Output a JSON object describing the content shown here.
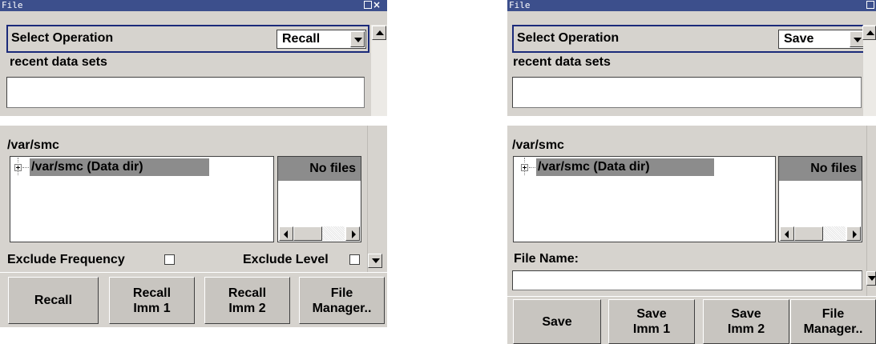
{
  "left": {
    "window_title": "File",
    "select_operation_label": "Select Operation",
    "operation_value": "Recall",
    "recent_label": "recent data sets",
    "path_label": "/var/smc",
    "tree_node": "/var/smc (Data dir)",
    "files_header": "No files",
    "exclude_frequency_label": "Exclude Frequency",
    "exclude_level_label": "Exclude Level",
    "buttons": [
      "Recall",
      "Recall\nImm 1",
      "Recall\nImm 2",
      "File\nManager.."
    ]
  },
  "right": {
    "window_title": "File",
    "select_operation_label": "Select Operation",
    "operation_value": "Save",
    "recent_label": "recent data sets",
    "path_label": "/var/smc",
    "tree_node": "/var/smc (Data dir)",
    "files_header": "No files",
    "file_name_label": "File Name:",
    "buttons": [
      "Save",
      "Save\nImm 1",
      "Save\nImm 2",
      "File\nManager.."
    ]
  },
  "icons": {
    "maximize": "maximize-icon",
    "close": "close-icon",
    "tree_expand": "plus-box-icon",
    "scroll_up": "arrow-up-icon",
    "scroll_down": "arrow-down-icon",
    "scroll_left": "arrow-left-icon",
    "scroll_right": "arrow-right-icon"
  },
  "colors": {
    "titlebar": "#3c4f8c",
    "panel": "#d6d3ce",
    "selection": "#8c8c8c",
    "focus_border": "#1b2a7a"
  }
}
